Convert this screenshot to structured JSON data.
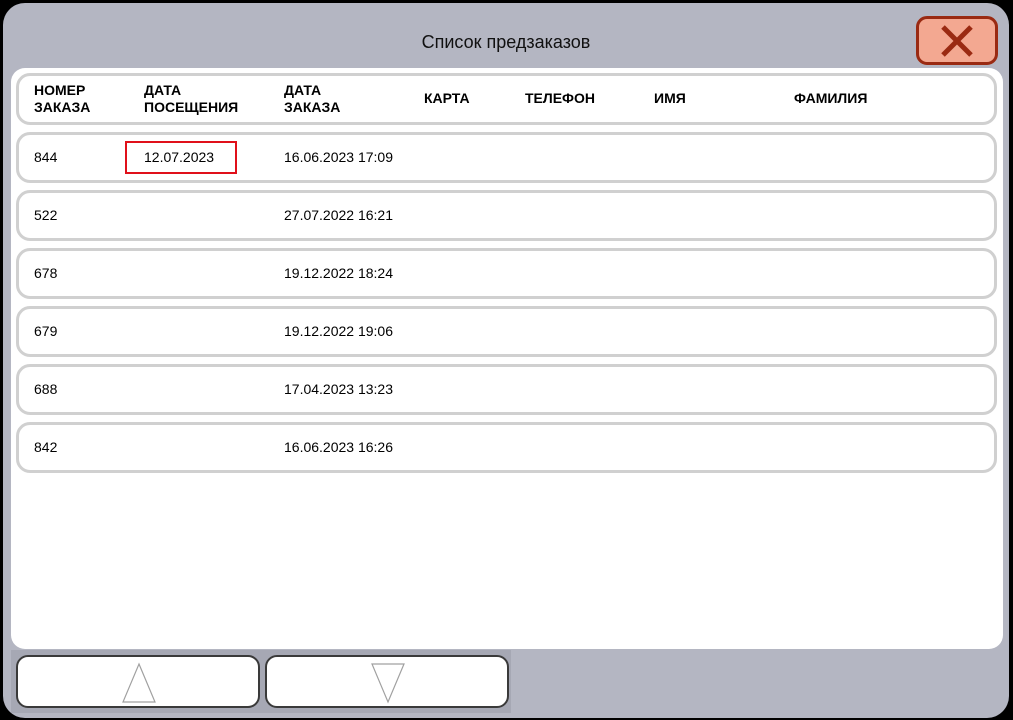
{
  "window": {
    "title": "Список предзаказов"
  },
  "close_button": {
    "icon": "close-icon",
    "color": "#f3a891",
    "icon_color": "#9a2a12"
  },
  "table": {
    "headers": [
      [
        "НОМЕР",
        "ЗАКАЗА"
      ],
      [
        "ДАТА",
        "ПОСЕЩЕНИЯ"
      ],
      [
        "ДАТА",
        "ЗАКАЗА"
      ],
      [
        "КАРТА"
      ],
      [
        "ТЕЛЕФОН"
      ],
      [
        "ИМЯ"
      ],
      [
        "ФАМИЛИЯ"
      ]
    ],
    "rows": [
      {
        "order": "844",
        "visit_date": "12.07.2023",
        "order_date": "16.06.2023 17:09",
        "card": "",
        "phone": "",
        "name": "",
        "surname": ""
      },
      {
        "order": "522",
        "visit_date": "",
        "order_date": "27.07.2022 16:21",
        "card": "",
        "phone": "",
        "name": "",
        "surname": ""
      },
      {
        "order": "678",
        "visit_date": "",
        "order_date": "19.12.2022 18:24",
        "card": "",
        "phone": "",
        "name": "",
        "surname": ""
      },
      {
        "order": "679",
        "visit_date": "",
        "order_date": "19.12.2022 19:06",
        "card": "",
        "phone": "",
        "name": "",
        "surname": ""
      },
      {
        "order": "688",
        "visit_date": "",
        "order_date": "17.04.2023 13:23",
        "card": "",
        "phone": "",
        "name": "",
        "surname": ""
      },
      {
        "order": "842",
        "visit_date": "",
        "order_date": "16.06.2023 16:26",
        "card": "",
        "phone": "",
        "name": "",
        "surname": ""
      }
    ],
    "highlight_color": "#e0101a"
  },
  "navigation": {
    "up_icon": "triangle-up-icon",
    "down_icon": "triangle-down-icon"
  }
}
